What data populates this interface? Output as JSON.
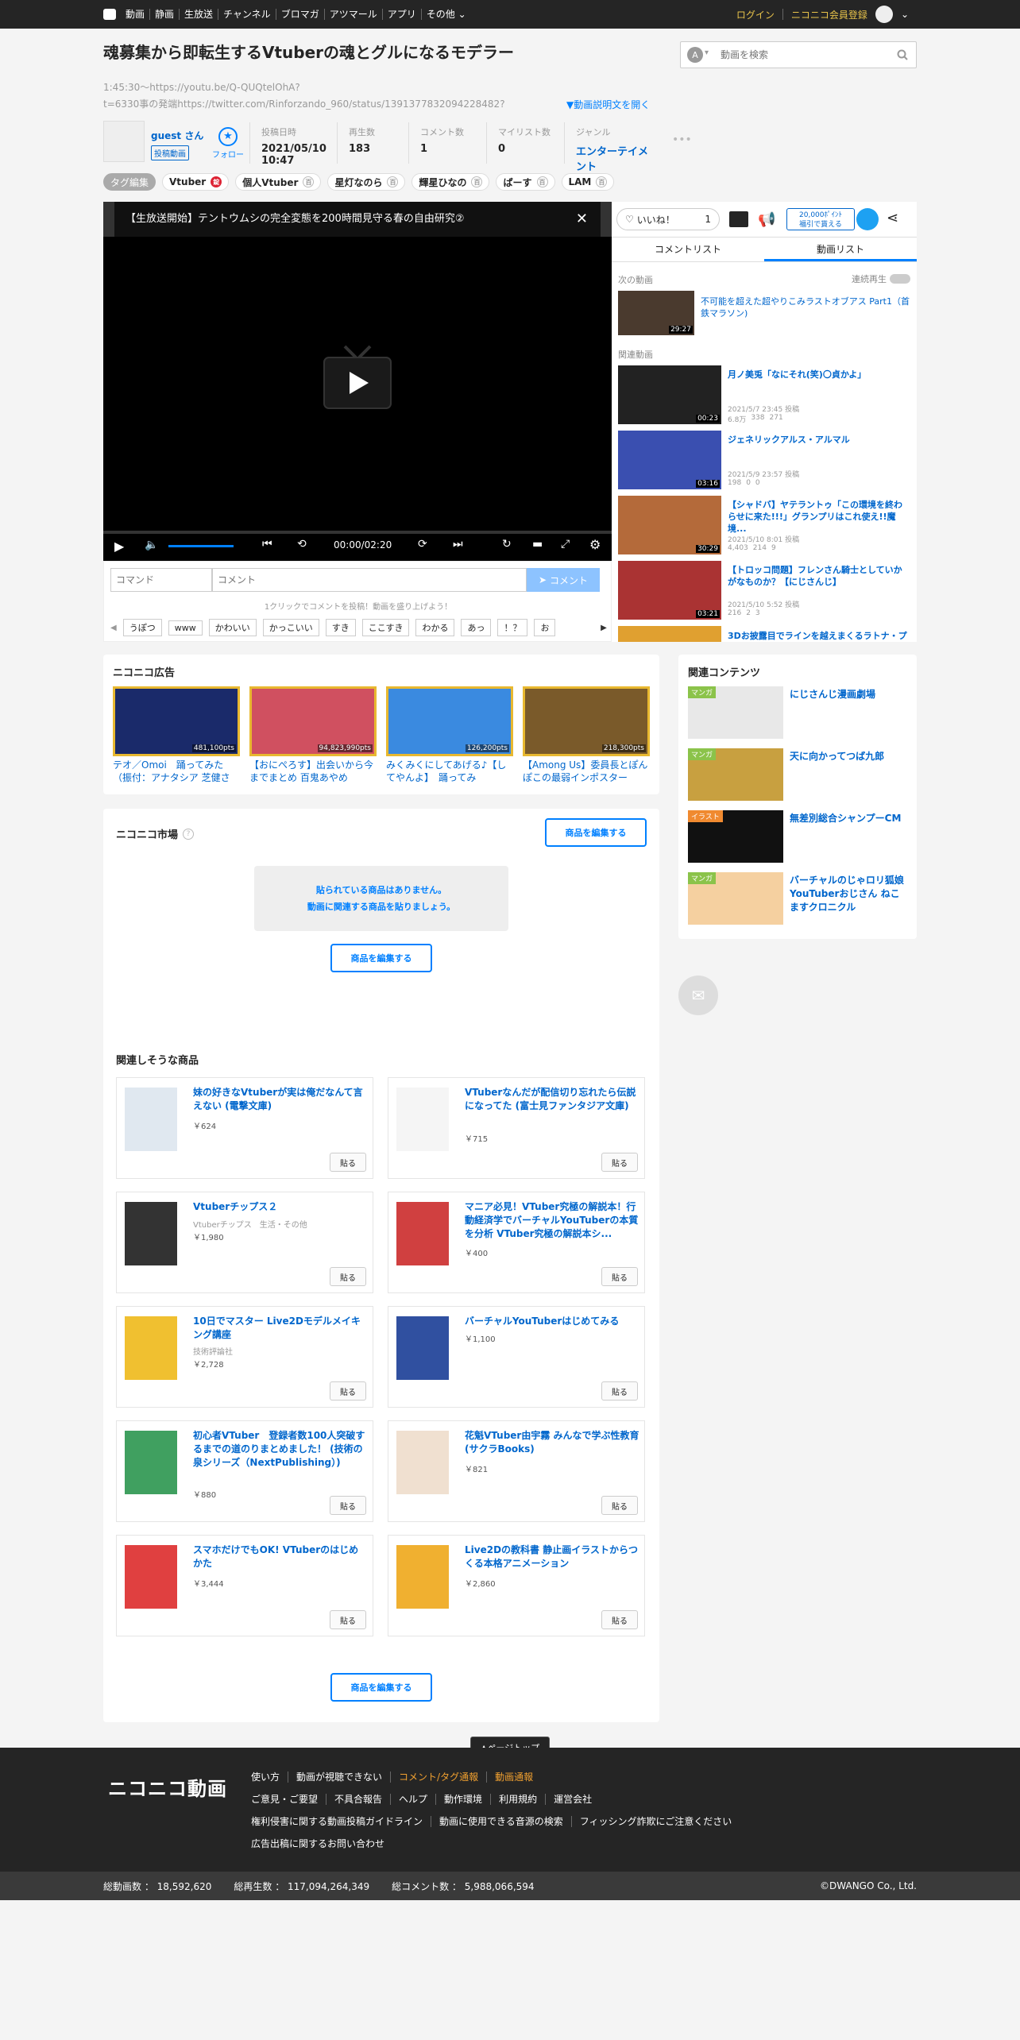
{
  "topbar": {
    "nav": [
      "動画",
      "静画",
      "生放送",
      "チャンネル",
      "ブロマガ",
      "アツマール",
      "アプリ",
      "その他"
    ],
    "login": "ログイン",
    "register": "ニコニコ会員登録"
  },
  "search": {
    "placeholder": "動画を検索"
  },
  "video": {
    "title": "魂募集から即転生するVtuberの魂とグルになるモデラー",
    "desc_line1": "1:45:30～https://youtu.be/Q-QUQtelOhA?",
    "desc_line2": "t=6330事の発端https://twitter.com/Rinforzando_960/status/1391377832094228482?",
    "desc_toggle": "▼動画説明文を開く",
    "user_name": "guest さん",
    "user_badge": "投稿動画",
    "follow": "フォロー",
    "meta": [
      {
        "label": "投稿日時",
        "value": "2021/05/10 10:47"
      },
      {
        "label": "再生数",
        "value": "183"
      },
      {
        "label": "コメント数",
        "value": "1"
      },
      {
        "label": "マイリスト数",
        "value": "0"
      },
      {
        "label": "ジャンル",
        "value": "エンターテイメント"
      }
    ],
    "more": "•••"
  },
  "tags": {
    "edit": "タグ編集",
    "items": [
      "Vtuber",
      "個人Vtuber",
      "星灯なのら",
      "輝星ひなの",
      "ぱーす",
      "LAM"
    ]
  },
  "player": {
    "title": "【生放送開始】テントウムシの完全変態を200時間見守る春の自由研究②",
    "time": "00:00/02:20",
    "command_placeholder": "コマンド",
    "comment_placeholder": "コメント",
    "comment_button": "コメント",
    "hint": "1クリックでコメントを投稿！動画を盛り上げよう！",
    "quick": [
      "うぽつ",
      "www",
      "かわいい",
      "かっこいい",
      "すき",
      "ここすき",
      "わかる",
      "あっ",
      "！？",
      "お"
    ]
  },
  "side": {
    "like": "いいね！",
    "like_count": "1",
    "points_top": "20,000ﾎﾟｲﾝﾄ",
    "points_bottom": "福引で貰える",
    "tab_comment": "コメントリスト",
    "tab_video": "動画リスト",
    "next_label": "次の動画",
    "autoplay": "連続再生",
    "next_video": {
      "title": "不可能を超えた超やりこみラストオブアス Part1（首鉄マラソン)",
      "duration": "29:27"
    },
    "related_label": "関連動画",
    "related": [
      {
        "title": "月ノ美兎「なにそれ(笑)〇貞かよ」",
        "date": "2021/5/7 23:45 投稿",
        "views": "6.8万",
        "comments": "338",
        "mylists": "271",
        "duration": "00:23"
      },
      {
        "title": "ジェネリックアルス・アルマル",
        "date": "2021/5/9 23:57 投稿",
        "views": "198",
        "comments": "0",
        "mylists": "0",
        "duration": "03:16"
      },
      {
        "title": "【シャドバ】ヤテラントゥ「この環境を終わらせに来た!!!」グランプリはこれ使え!!魔境...",
        "date": "2021/5/10 8:01 投稿",
        "views": "4,403",
        "comments": "214",
        "mylists": "9",
        "duration": "30:29"
      },
      {
        "title": "【トロッコ問題】フレンさん騎士としていかがなものか？【にじさんじ】",
        "date": "2021/5/10 5:52 投稿",
        "views": "216",
        "comments": "2",
        "mylists": "3",
        "duration": "03:21"
      },
      {
        "title": "3Dお披露目でラインを越えまくるラトナ・プ",
        "date": "",
        "views": "",
        "comments": "",
        "mylists": "",
        "duration": ""
      }
    ]
  },
  "ads": {
    "title": "ニコニコ広告",
    "items": [
      {
        "title": "テオ／Omoi　踊ってみた（振付：アナタシア 芝健さ",
        "pts": "481,100pts"
      },
      {
        "title": "【おにぺろす】出会いから今までまとめ 百鬼あやめ",
        "pts": "94,823,990pts"
      },
      {
        "title": "みくみくにしてあげる♪【してやんよ】　踊ってみ",
        "pts": "126,200pts"
      },
      {
        "title": "【Among Us】委員長とぽんぽこの最弱インポスター",
        "pts": "218,300pts"
      }
    ]
  },
  "contents": {
    "title": "関連コンテンツ",
    "items": [
      {
        "badge": "マンガ",
        "title": "にじさんじ漫画劇場"
      },
      {
        "badge": "マンガ",
        "title": "天に向かってつば九郎"
      },
      {
        "badge": "イラスト",
        "title": "無差別総合シャンプーCM"
      },
      {
        "badge": "マンガ",
        "title": "バーチャルのじゃロリ狐娘YouTuberおじさん ねこますクロニクル"
      }
    ]
  },
  "market": {
    "title": "ニコニコ市場",
    "edit": "商品を編集する",
    "empty_line1": "貼られている商品はありません。",
    "empty_line2": "動画に関連する商品を貼りましょう。",
    "related_title": "関連しそうな商品",
    "paste": "貼る",
    "products": [
      {
        "title": "妹の好きなVtuberが実は俺だなんて言えない (電撃文庫)",
        "sub": "",
        "price": "￥624"
      },
      {
        "title": "VTuberなんだが配信切り忘れたら伝説になってた (富士見ファンタジア文庫)",
        "sub": "",
        "price": "￥715"
      },
      {
        "title": "Vtuberチップス２",
        "sub": "Vtuberチップス　生活・その他",
        "price": "￥1,980"
      },
      {
        "title": "マニア必見！VTuber究極の解説本！行動経済学でバーチャルYouTuberの本質を分析 VTuber究極の解説本シ...",
        "sub": "",
        "price": "￥400"
      },
      {
        "title": "10日でマスター Live2Dモデルメイキング講座",
        "sub": "技術評論社",
        "price": "￥2,728"
      },
      {
        "title": "バーチャルYouTuberはじめてみる",
        "sub": "",
        "price": "￥1,100"
      },
      {
        "title": "初心者VTuber　登録者数100人突破するまでの道のりまとめました！ (技術の泉シリーズ（NextPublishing）)",
        "sub": "",
        "price": "￥880"
      },
      {
        "title": "花魁VTuber由宇霧 みんなで学ぶ性教育 (サクラBooks)",
        "sub": "",
        "price": "￥821"
      },
      {
        "title": "スマホだけでもOK! VTuberのはじめかた",
        "sub": "",
        "price": "￥3,444"
      },
      {
        "title": "Live2Dの教科書 静止画イラストからつくる本格アニメーション",
        "sub": "",
        "price": "￥2,860"
      }
    ]
  },
  "pagetop": "▲ページトップ",
  "footer": {
    "logo": "ニコニコ動画",
    "row1": [
      "使い方",
      "動画が視聴できない",
      "コメント/タグ通報",
      "動画通報"
    ],
    "row2": [
      "ご意見・ご要望",
      "不具合報告",
      "ヘルプ",
      "動作環境",
      "利用規約",
      "運営会社"
    ],
    "row3": [
      "権利侵害に関する動画投稿ガイドライン",
      "動画に使用できる音源の検索",
      "フィッシング詐欺にご注意ください"
    ],
    "row4": [
      "広告出稿に関するお問い合わせ"
    ],
    "stats": [
      {
        "label": "総動画数 ：",
        "value": "18,592,620"
      },
      {
        "label": "総再生数 ：",
        "value": "117,094,264,349"
      },
      {
        "label": "総コメント数 ：",
        "value": "5,988,066,594"
      }
    ],
    "copyright": "©DWANGO Co., Ltd."
  }
}
